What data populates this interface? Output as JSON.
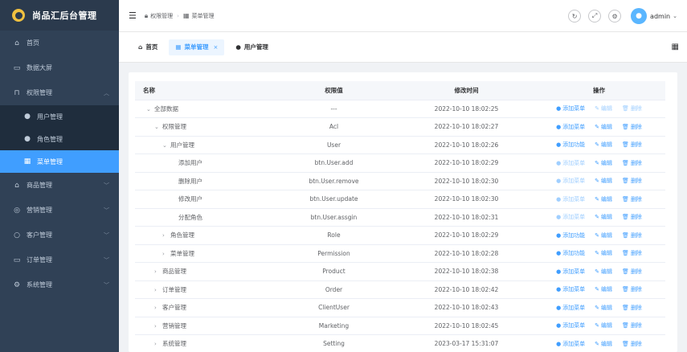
{
  "app": {
    "title": "尚品汇后台管理"
  },
  "sidebar": {
    "items": [
      {
        "label": "首页",
        "icon": "home-icon"
      },
      {
        "label": "数据大屏",
        "icon": "monitor-icon"
      },
      {
        "label": "权限管理",
        "icon": "lock-icon",
        "expanded": true,
        "children": [
          {
            "label": "用户管理",
            "icon": "user-icon"
          },
          {
            "label": "角色管理",
            "icon": "user-icon"
          },
          {
            "label": "菜单管理",
            "icon": "grid-icon",
            "active": true
          }
        ]
      },
      {
        "label": "商品管理",
        "icon": "shop-icon"
      },
      {
        "label": "营销管理",
        "icon": "coin-icon"
      },
      {
        "label": "客户管理",
        "icon": "person-icon"
      },
      {
        "label": "订单管理",
        "icon": "cart-icon"
      },
      {
        "label": "系统管理",
        "icon": "gear-icon"
      }
    ]
  },
  "header": {
    "breadcrumb": [
      "权限管理",
      "菜单管理"
    ],
    "user": "admin"
  },
  "tabs": [
    {
      "label": "首页"
    },
    {
      "label": "菜单管理",
      "active": true
    },
    {
      "label": "用户管理"
    }
  ],
  "table": {
    "columns": [
      "名称",
      "权限值",
      "修改时间",
      "操作"
    ],
    "rows": [
      {
        "level": 0,
        "arrow": "expanded",
        "name": "全部数据",
        "code": "---",
        "time": "2022-10-10 18:02:25",
        "add": "添加菜单",
        "add_enabled": true,
        "edit_enabled": false,
        "del_enabled": false
      },
      {
        "level": 1,
        "arrow": "expanded",
        "name": "权限管理",
        "code": "Acl",
        "time": "2022-10-10 18:02:27",
        "add": "添加菜单",
        "add_enabled": true,
        "edit_enabled": true,
        "del_enabled": true
      },
      {
        "level": 2,
        "arrow": "expanded",
        "name": "用户管理",
        "code": "User",
        "time": "2022-10-10 18:02:26",
        "add": "添加功能",
        "add_enabled": true,
        "edit_enabled": true,
        "del_enabled": true
      },
      {
        "level": 3,
        "arrow": "none",
        "name": "添加用户",
        "code": "btn.User.add",
        "time": "2022-10-10 18:02:29",
        "add": "添加菜单",
        "add_enabled": false,
        "edit_enabled": true,
        "del_enabled": true
      },
      {
        "level": 3,
        "arrow": "none",
        "name": "删除用户",
        "code": "btn.User.remove",
        "time": "2022-10-10 18:02:30",
        "add": "添加菜单",
        "add_enabled": false,
        "edit_enabled": true,
        "del_enabled": true
      },
      {
        "level": 3,
        "arrow": "none",
        "name": "修改用户",
        "code": "btn.User.update",
        "time": "2022-10-10 18:02:30",
        "add": "添加菜单",
        "add_enabled": false,
        "edit_enabled": true,
        "del_enabled": true
      },
      {
        "level": 3,
        "arrow": "none",
        "name": "分配角色",
        "code": "btn.User.assgin",
        "time": "2022-10-10 18:02:31",
        "add": "添加菜单",
        "add_enabled": false,
        "edit_enabled": true,
        "del_enabled": true
      },
      {
        "level": 2,
        "arrow": "collapsed",
        "name": "角色管理",
        "code": "Role",
        "time": "2022-10-10 18:02:29",
        "add": "添加功能",
        "add_enabled": true,
        "edit_enabled": true,
        "del_enabled": true
      },
      {
        "level": 2,
        "arrow": "collapsed",
        "name": "菜单管理",
        "code": "Permission",
        "time": "2022-10-10 18:02:28",
        "add": "添加功能",
        "add_enabled": true,
        "edit_enabled": true,
        "del_enabled": true
      },
      {
        "level": 1,
        "arrow": "collapsed",
        "name": "商品管理",
        "code": "Product",
        "time": "2022-10-10 18:02:38",
        "add": "添加菜单",
        "add_enabled": true,
        "edit_enabled": true,
        "del_enabled": true
      },
      {
        "level": 1,
        "arrow": "collapsed",
        "name": "订单管理",
        "code": "Order",
        "time": "2022-10-10 18:02:42",
        "add": "添加菜单",
        "add_enabled": true,
        "edit_enabled": true,
        "del_enabled": true
      },
      {
        "level": 1,
        "arrow": "collapsed",
        "name": "客户管理",
        "code": "ClientUser",
        "time": "2022-10-10 18:02:43",
        "add": "添加菜单",
        "add_enabled": true,
        "edit_enabled": true,
        "del_enabled": true
      },
      {
        "level": 1,
        "arrow": "collapsed",
        "name": "营销管理",
        "code": "Marketing",
        "time": "2022-10-10 18:02:45",
        "add": "添加菜单",
        "add_enabled": true,
        "edit_enabled": true,
        "del_enabled": true
      },
      {
        "level": 1,
        "arrow": "collapsed",
        "name": "系统管理",
        "code": "Setting",
        "time": "2023-03-17 15:31:07",
        "add": "添加菜单",
        "add_enabled": true,
        "edit_enabled": true,
        "del_enabled": true
      }
    ],
    "edit_label": "编辑",
    "delete_label": "删除"
  },
  "colors": {
    "sidebar_bg": "#304156",
    "accent": "#409eff",
    "disabled_link": "#a0cfff"
  }
}
